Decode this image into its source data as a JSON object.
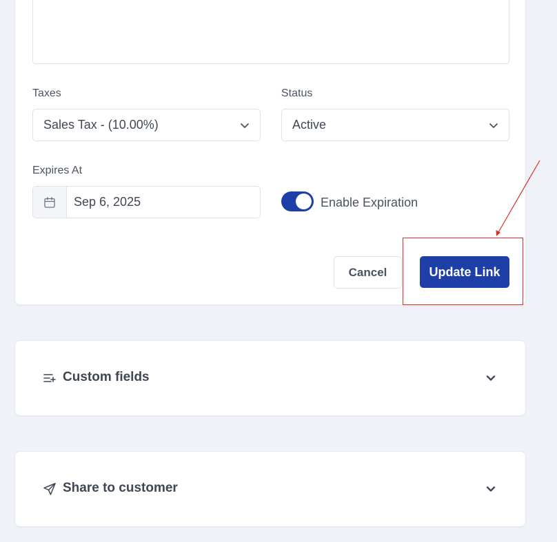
{
  "form": {
    "taxes_label": "Taxes",
    "taxes_value": "Sales Tax - (10.00%)",
    "status_label": "Status",
    "status_value": "Active",
    "expires_label": "Expires At",
    "expires_value": "Sep 6, 2025",
    "enable_expiration_label": "Enable Expiration",
    "enable_expiration_on": true
  },
  "actions": {
    "cancel_label": "Cancel",
    "update_label": "Update Link"
  },
  "sections": {
    "custom_fields_title": "Custom fields",
    "share_title": "Share to customer"
  },
  "icons": {
    "calendar": "calendar-icon",
    "chevron": "chevron-down-icon",
    "custom_fields": "list-plus-icon",
    "share": "send-icon"
  },
  "colors": {
    "primary": "#1e3ea8",
    "annotation": "#d9302c",
    "background": "#eff2f7"
  }
}
